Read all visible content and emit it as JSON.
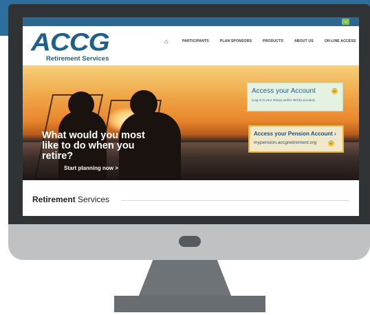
{
  "colors": {
    "accent": "#1e5f8f",
    "topbar": "#2a6890",
    "pension_border": "#e8b73a"
  },
  "icons": {
    "home": "home-icon",
    "lock": "lock-icon",
    "chevron": "chevron-down-icon"
  },
  "site": {
    "logo_main": "ACCG",
    "logo_sub": "Retirement Services",
    "nav": {
      "items": [
        "PARTICIPANTS",
        "PLAN SPONSORS",
        "PRODUCTS",
        "ABOUT US",
        "ON-LINE ACCESS"
      ]
    }
  },
  "hero": {
    "headline": "What would you most like to do when you retire?",
    "cta": "Start planning now >",
    "account": {
      "title": "Access your Account",
      "subtitle": "(Log in to your 401(a) and/or 457(b) account)"
    },
    "pension": {
      "title": "Access your Pension Account ›",
      "subtitle": "mypension.accgretirement.org"
    }
  },
  "section": {
    "title_bold": "Retirement",
    "title_rest": " Services"
  }
}
